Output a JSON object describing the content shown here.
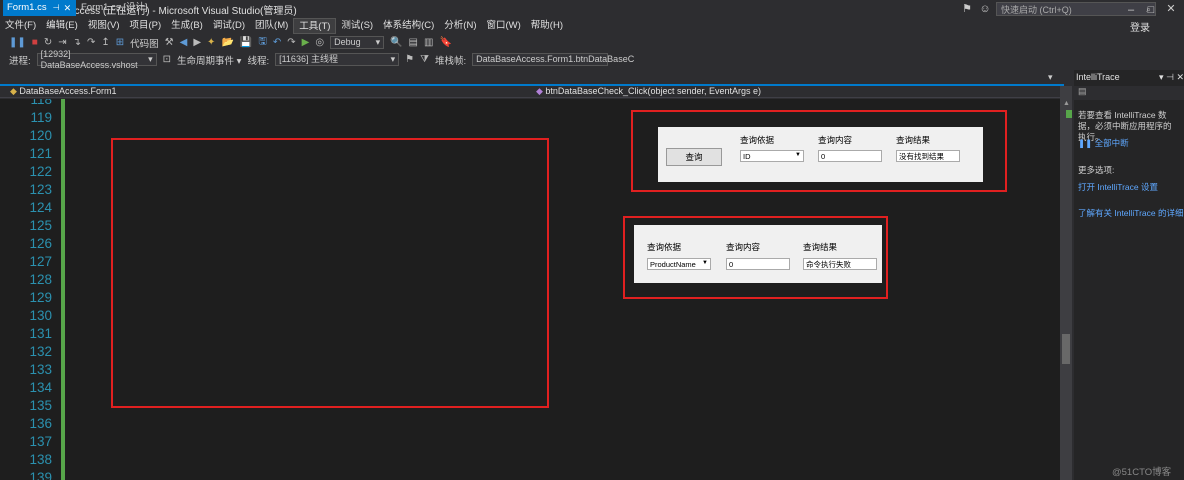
{
  "window": {
    "title": "DataBaseAccess (正在运行) - Microsoft Visual Studio(管理员)",
    "quick_launch_placeholder": "快速启动 (Ctrl+Q)",
    "login": "登录"
  },
  "menu": [
    "文件(F)",
    "编辑(E)",
    "视图(V)",
    "项目(P)",
    "生成(B)",
    "调试(D)",
    "团队(M)",
    "工具(T)",
    "测试(S)",
    "体系结构(C)",
    "分析(N)",
    "窗口(W)",
    "帮助(H)"
  ],
  "toolbar": {
    "code_map": "代码图",
    "config": "Debug",
    "process_label": "进程:",
    "process": "[12932] DataBaseAccess.vshost",
    "lifecycle": "生命周期事件 ▾",
    "thread_label": "线程:",
    "thread": "[11636] 主线程",
    "stack_label": "堆栈帧:",
    "stack": "DataBaseAccess.Form1.btnDataBaseC"
  },
  "tabs": [
    {
      "label": "Form1.cs",
      "active": true
    },
    {
      "label": "Form1.cs [设计]",
      "active": false
    }
  ],
  "nav": {
    "class": "DataBaseAccess.Form1",
    "member": "btnDataBaseCheck_Click(object sender, EventArgs e)"
  },
  "editor": {
    "line_numbers": [
      "118",
      "119",
      "120",
      "121",
      "122",
      "123",
      "124",
      "125",
      "126",
      "127",
      "128",
      "129",
      "130",
      "131",
      "132",
      "133",
      "134",
      "135",
      "136",
      "137",
      "138",
      "139"
    ]
  },
  "panel": {
    "title": "IntelliTrace",
    "intro": "若要查看 IntelliTrace 数据，必须中断应用程序的执行。",
    "break_all": "全部中断",
    "more_options": "更多选项:",
    "open_settings": "打开 IntelliTrace 设置",
    "learn_more": "了解有关 IntelliTrace 的详细"
  },
  "inset1": {
    "query_by_label": "查询依据",
    "query_content_label": "查询内容",
    "query_result_label": "查询结果",
    "button": "查询",
    "query_by_value": "ID",
    "query_content_value": "0",
    "query_result_value": "没有找到结果"
  },
  "inset2": {
    "query_by_label": "查询依据",
    "query_content_label": "查询内容",
    "query_result_label": "查询结果",
    "query_by_value": "ProductName",
    "query_content_value": "0",
    "query_result_value": "命令执行失败"
  },
  "watermark": "@51CTO博客",
  "colors": {
    "accent": "#007acc",
    "highlight_box": "#e02020"
  }
}
